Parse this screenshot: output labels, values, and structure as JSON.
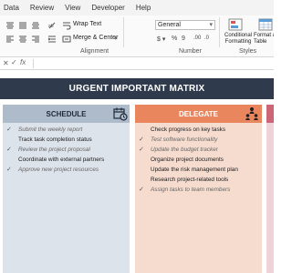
{
  "menu": [
    "Data",
    "Review",
    "View",
    "Developer",
    "Help"
  ],
  "ribbon": {
    "wrap_text": "Wrap Text",
    "merge_center": "Merge & Center",
    "number_format": "General",
    "conditional_formatting": "Conditional Formatting",
    "format_as_table": "Format as Table",
    "groups": [
      "Alignment",
      "Number",
      "Styles"
    ]
  },
  "formula_bar": {
    "fx": "fx"
  },
  "matrix": {
    "title": "URGENT IMPORTANT MATRIX",
    "quadrants": [
      {
        "name": "SCHEDULE",
        "icon": "calendar-clock-icon",
        "tasks": [
          {
            "text": "Submit the weekly report",
            "done": true
          },
          {
            "text": "Track task completion status",
            "done": false
          },
          {
            "text": "Review the project proposal",
            "done": true
          },
          {
            "text": "Coordinate with external partners",
            "done": false
          },
          {
            "text": "Approve new project resources",
            "done": true
          }
        ]
      },
      {
        "name": "DELEGATE",
        "icon": "org-chart-icon",
        "tasks": [
          {
            "text": "Check progress on key tasks",
            "done": false
          },
          {
            "text": "Test software functionality",
            "done": true
          },
          {
            "text": "Update the budget tracker",
            "done": true
          },
          {
            "text": "Organize project documents",
            "done": false
          },
          {
            "text": "Update the risk management plan",
            "done": false
          },
          {
            "text": "Research project-related tools",
            "done": false
          },
          {
            "text": "Assign tasks to team members",
            "done": true
          }
        ]
      }
    ]
  },
  "colors": {
    "title_bg": "#2f3b4c",
    "schedule_header": "#aebbca",
    "schedule_body": "#dde3ea",
    "delegate_header": "#e9865e",
    "delegate_body": "#f6dccf"
  }
}
